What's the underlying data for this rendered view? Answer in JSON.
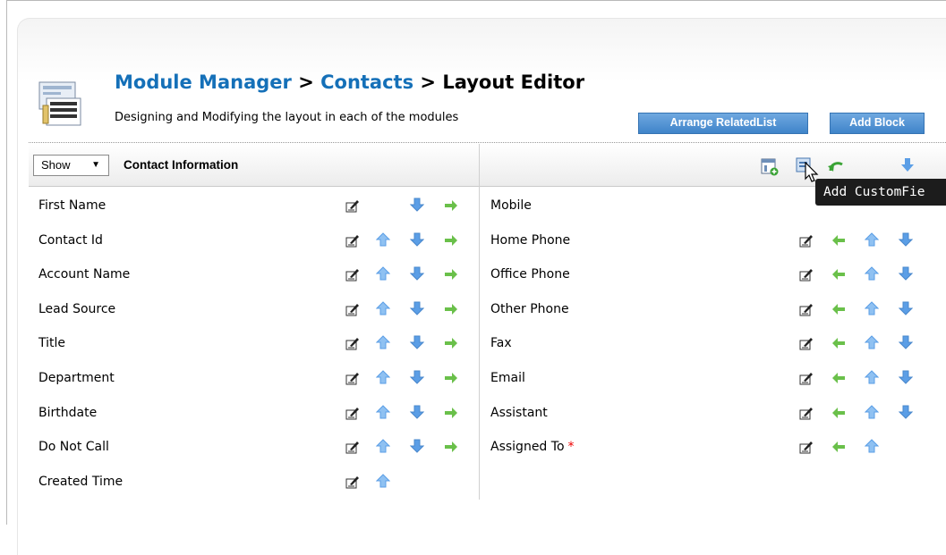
{
  "breadcrumb": {
    "module_manager": "Module Manager",
    "sep1": " > ",
    "contacts": "Contacts",
    "sep2": " > ",
    "current": "Layout Editor"
  },
  "subtitle": "Designing and Modifying the layout in each of the modules",
  "buttons": {
    "arrange": "Arrange RelatedList",
    "add_block": "Add Block"
  },
  "block": {
    "show_label": "Show",
    "show_caret": "▼",
    "title": "Contact Information",
    "tooltip": "Add CustomFie"
  },
  "left_fields": [
    {
      "label": "First Name"
    },
    {
      "label": "Contact Id"
    },
    {
      "label": "Account Name"
    },
    {
      "label": "Lead Source"
    },
    {
      "label": "Title"
    },
    {
      "label": "Department"
    },
    {
      "label": "Birthdate"
    },
    {
      "label": "Do Not Call"
    },
    {
      "label": "Created Time"
    }
  ],
  "right_fields": [
    {
      "label": "Mobile"
    },
    {
      "label": "Home Phone"
    },
    {
      "label": "Office Phone"
    },
    {
      "label": "Other Phone"
    },
    {
      "label": "Fax"
    },
    {
      "label": "Email"
    },
    {
      "label": "Assistant"
    },
    {
      "label": "Assigned To",
      "required": "*"
    }
  ],
  "colors": {
    "link": "#1570b8",
    "button": "#3f84c9",
    "tooltip": "#1c1c1c",
    "arrow_blue": "#5b9ee6",
    "arrow_green": "#5cbf3b",
    "required": "#e00000"
  }
}
